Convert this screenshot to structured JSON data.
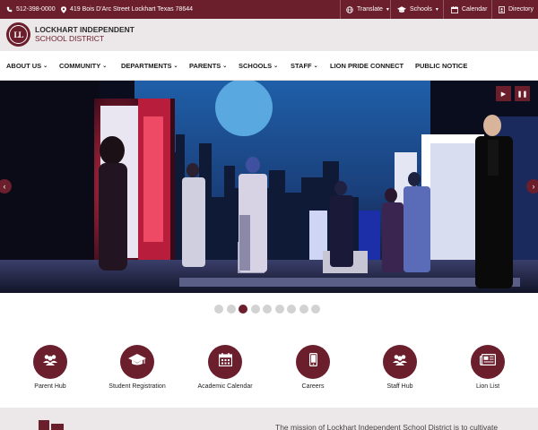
{
  "topbar": {
    "phone": "512-398-0000",
    "address": "419 Bois D'Arc Street Lockhart Texas 78644",
    "translate": "Translate",
    "schools": "Schools",
    "calendar": "Calendar",
    "directory": "Directory"
  },
  "logo": {
    "monogram": "LL",
    "line1": "LOCKHART INDEPENDENT",
    "line2": "SCHOOL DISTRICT"
  },
  "nav": {
    "items": [
      {
        "label": "ABOUT US",
        "dropdown": true
      },
      {
        "label": "COMMUNITY",
        "dropdown": true
      },
      {
        "label": "DEPARTMENTS",
        "dropdown": true
      },
      {
        "label": "PARENTS",
        "dropdown": true
      },
      {
        "label": "SCHOOLS",
        "dropdown": true
      },
      {
        "label": "STAFF",
        "dropdown": true
      },
      {
        "label": "LION PRIDE CONNECT",
        "dropdown": false
      },
      {
        "label": "PUBLIC NOTICE",
        "dropdown": false
      }
    ]
  },
  "slider": {
    "slide_count": 9,
    "active_slide": 3,
    "play_icon": "play-icon",
    "pause_icon": "pause-icon"
  },
  "quick_links": [
    {
      "label": "Parent Hub",
      "icon": "users-icon"
    },
    {
      "label": "Student Registration",
      "icon": "graduation-cap-icon"
    },
    {
      "label": "Academic Calendar",
      "icon": "calendar-icon"
    },
    {
      "label": "Careers",
      "icon": "mobile-icon"
    },
    {
      "label": "Staff Hub",
      "icon": "users-icon"
    },
    {
      "label": "Lion List",
      "icon": "newspaper-icon"
    }
  ],
  "mission": {
    "text": "The mission of Lockhart Independent School District is to cultivate"
  },
  "colors": {
    "brand": "#6b1e2c",
    "band": "#ece8e9",
    "dot_inactive": "#d2d2d2"
  }
}
